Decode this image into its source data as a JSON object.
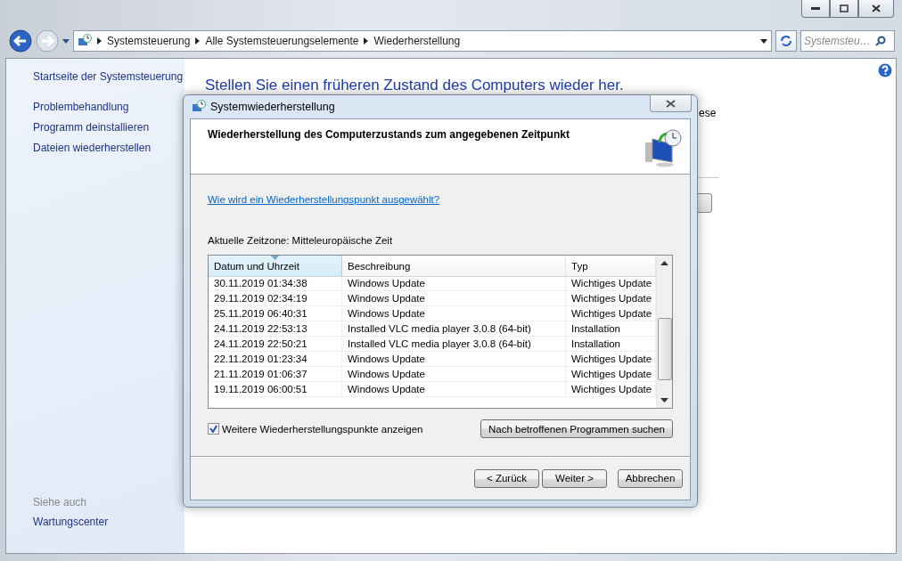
{
  "address": {
    "crumbs": [
      "Systemsteuerung",
      "Alle Systemsteuerungselemente",
      "Wiederherstellung"
    ],
    "search_placeholder": "Systemsteu…"
  },
  "sidebar": {
    "links": [
      "Startseite der Systemsteuerung",
      "Problembehandlung",
      "Programm deinstallieren",
      "Dateien wiederherstellen"
    ],
    "see_also_heading": "Siehe auch",
    "see_also": [
      "Wartungscenter"
    ]
  },
  "main": {
    "heading": "Stellen Sie einen früheren Zustand des Computers wieder her.",
    "cut_text": "ese"
  },
  "dialog": {
    "title": "Systemwiederherstellung",
    "header": "Wiederherstellung des Computerzustands zum angegebenen Zeitpunkt",
    "help_link": "Wie wird ein Wiederherstellungspunkt ausgewählt?",
    "timezone": "Aktuelle Zeitzone: Mitteleuropäische Zeit",
    "table": {
      "columns": [
        {
          "label": "Datum und Uhrzeit",
          "sorted": true
        },
        {
          "label": "Beschreibung",
          "sorted": false
        },
        {
          "label": "Typ",
          "sorted": false
        }
      ],
      "rows": [
        {
          "date": "30.11.2019 01:34:38",
          "description": "Windows Update",
          "type": "Wichtiges Update"
        },
        {
          "date": "29.11.2019 02:34:19",
          "description": "Windows Update",
          "type": "Wichtiges Update"
        },
        {
          "date": "25.11.2019 06:40:31",
          "description": "Windows Update",
          "type": "Wichtiges Update"
        },
        {
          "date": "24.11.2019 22:53:13",
          "description": "Installed VLC media player 3.0.8 (64-bit)",
          "type": "Installation"
        },
        {
          "date": "24.11.2019 22:50:21",
          "description": "Installed VLC media player 3.0.8 (64-bit)",
          "type": "Installation"
        },
        {
          "date": "22.11.2019 01:23:34",
          "description": "Windows Update",
          "type": "Wichtiges Update"
        },
        {
          "date": "21.11.2019 01:06:37",
          "description": "Windows Update",
          "type": "Wichtiges Update"
        },
        {
          "date": "19.11.2019 06:00:51",
          "description": "Windows Update",
          "type": "Wichtiges Update"
        }
      ]
    },
    "show_more": {
      "label": "Weitere Wiederherstellungspunkte anzeigen",
      "checked": true
    },
    "scan_button": "Nach betroffenen Programmen suchen",
    "buttons": [
      "< Zurück",
      "Weiter >",
      "Abbrechen"
    ]
  }
}
